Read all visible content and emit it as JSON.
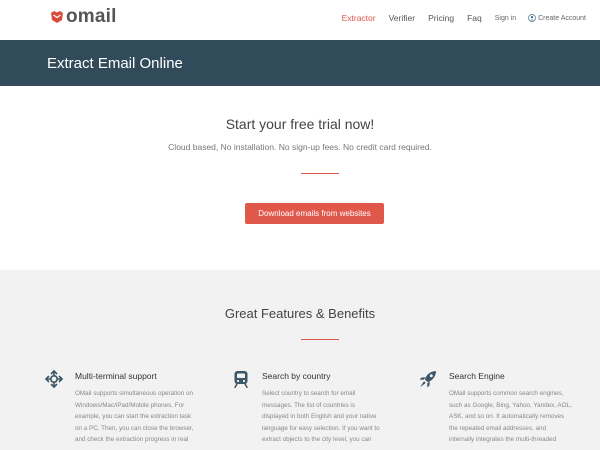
{
  "header": {
    "logo_text": "omail",
    "nav": [
      {
        "label": "Extractor",
        "active": true
      },
      {
        "label": "Verifier",
        "active": false
      },
      {
        "label": "Pricing",
        "active": false
      },
      {
        "label": "Faq",
        "active": false
      },
      {
        "label": "Sign in",
        "active": false
      }
    ],
    "create_account": "Create Account"
  },
  "band": {
    "title": "Extract Email Online"
  },
  "trial": {
    "title": "Start your free trial now!",
    "subtitle": "Cloud based, No installation. No sign-up fees. No credit card required.",
    "cta": "Download emails from websites"
  },
  "features": {
    "title": "Great Features & Benefits",
    "items": [
      {
        "icon": "crosshair-arrows-icon",
        "title": "Multi-terminal support",
        "lines": [
          "OMail supports simultaneous operation on",
          "Windows/Mac/iPad/Mobile phones, For",
          "example, you can start the extraction task",
          "on a PC. Then, you can close the browser,",
          "and check the extraction progress in real"
        ]
      },
      {
        "icon": "train-icon",
        "title": "Search by country",
        "lines": [
          "Select country to search for email",
          "messages. The list of countries is",
          "displayed in both English and your native",
          "language for easy selection. If you want to",
          "extract objects to the city level, you can"
        ]
      },
      {
        "icon": "rocket-icon",
        "title": "Search Engine",
        "lines": [
          "OMail supports common search engines,",
          "such as Google, Bing, Yahoo, Yandex, AOL,",
          "ASK, and so on. It automatically removes",
          "the repeated email addresses, and",
          "internally integrates the multi-threaded"
        ]
      }
    ]
  },
  "colors": {
    "accent": "#e0584a",
    "band": "#324b5a",
    "features_bg": "#f2f2f2",
    "icon": "#3b5666"
  }
}
